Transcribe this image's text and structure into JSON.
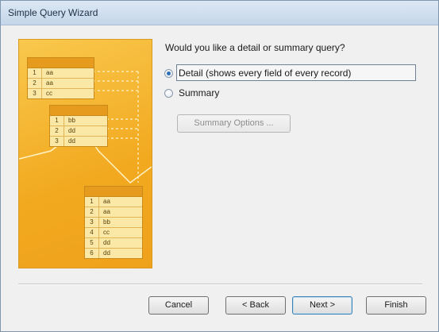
{
  "window": {
    "title": "Simple Query Wizard"
  },
  "question": "Would you like a detail or summary query?",
  "options": [
    {
      "label": "Detail (shows every field of every record)",
      "selected": true
    },
    {
      "label": "Summary",
      "selected": false
    }
  ],
  "summary_options_label": "Summary Options ...",
  "buttons": {
    "cancel": "Cancel",
    "back": "< Back",
    "next": "Next >",
    "finish": "Finish"
  },
  "illustration": {
    "table1": [
      {
        "id": "1",
        "val": "aa"
      },
      {
        "id": "2",
        "val": "aa"
      },
      {
        "id": "3",
        "val": "cc"
      }
    ],
    "table2": [
      {
        "id": "1",
        "val": "bb"
      },
      {
        "id": "2",
        "val": "dd"
      },
      {
        "id": "3",
        "val": "dd"
      }
    ],
    "table3": [
      {
        "id": "1",
        "val": "aa"
      },
      {
        "id": "2",
        "val": "aa"
      },
      {
        "id": "3",
        "val": "bb"
      },
      {
        "id": "4",
        "val": "cc"
      },
      {
        "id": "5",
        "val": "dd"
      },
      {
        "id": "6",
        "val": "dd"
      }
    ]
  },
  "colors": {
    "illustration_bg": "#f2a91f",
    "table_header": "#e79b1e",
    "radio_dot": "#2d6fb6"
  }
}
